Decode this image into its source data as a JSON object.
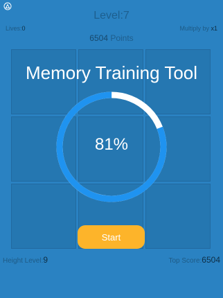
{
  "header": {
    "level_label": "Level:",
    "level_value": "7",
    "lives_label": "Lives:",
    "lives_value": "0",
    "multiply_label": "Multiply by ",
    "multiply_value": "x1",
    "points_value": "6504",
    "points_label": " Points"
  },
  "overlay": {
    "title": "Memory Training Tool",
    "progress": 0.81,
    "percent_text": "81%",
    "start_label": "Start"
  },
  "footer": {
    "height_level_label": "Height Level:",
    "height_level_value": "9",
    "top_score_label": "Top Score:",
    "top_score_value": "6504"
  },
  "colors": {
    "background": "#2a82c2",
    "tile": "#2577b1",
    "progress_fill": "#1f93f0",
    "progress_track": "#ffffff",
    "button": "#fdb42a"
  },
  "icons": {
    "corner": "gear-icon"
  },
  "grid": {
    "rows": 3,
    "columns": 3
  }
}
